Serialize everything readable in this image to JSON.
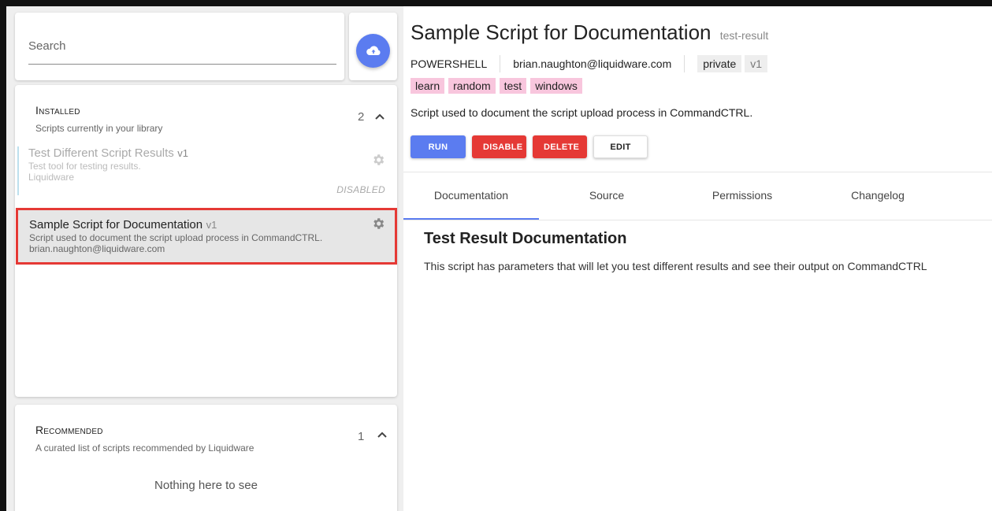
{
  "search": {
    "placeholder": "Search"
  },
  "installed": {
    "title": "Installed",
    "subtitle": "Scripts currently in your library",
    "count": "2",
    "items": [
      {
        "name": "Test Different Script Results",
        "version": "v1",
        "description": "Test tool for testing results.",
        "author": "Liquidware",
        "status": "DISABLED"
      },
      {
        "name": "Sample Script for Documentation",
        "version": "v1",
        "description": "Script used to document the script upload process in CommandCTRL.",
        "author": "brian.naughton@liquidware.com"
      }
    ]
  },
  "recommended": {
    "title": "Recommended",
    "subtitle": "A curated list of scripts recommended by Liquidware",
    "count": "1",
    "empty": "Nothing here to see"
  },
  "detail": {
    "title": "Sample Script for Documentation",
    "slug": "test-result",
    "language": "POWERSHELL",
    "author": "brian.naughton@liquidware.com",
    "visibility": "private",
    "version": "v1",
    "tags": [
      "learn",
      "random",
      "test",
      "windows"
    ],
    "description": "Script used to document the script upload process in CommandCTRL.",
    "actions": {
      "run": "RUN",
      "disable": "DISABLE",
      "delete": "DELETE",
      "edit": "EDIT"
    },
    "tabs": [
      "Documentation",
      "Source",
      "Permissions",
      "Changelog"
    ],
    "doc_heading": "Test Result Documentation",
    "doc_body": "This script has parameters that will let you test different results and see their output on CommandCTRL"
  },
  "colors": {
    "accent": "#5b7cf0",
    "danger": "#e53935",
    "tag": "#f8c6dd"
  }
}
